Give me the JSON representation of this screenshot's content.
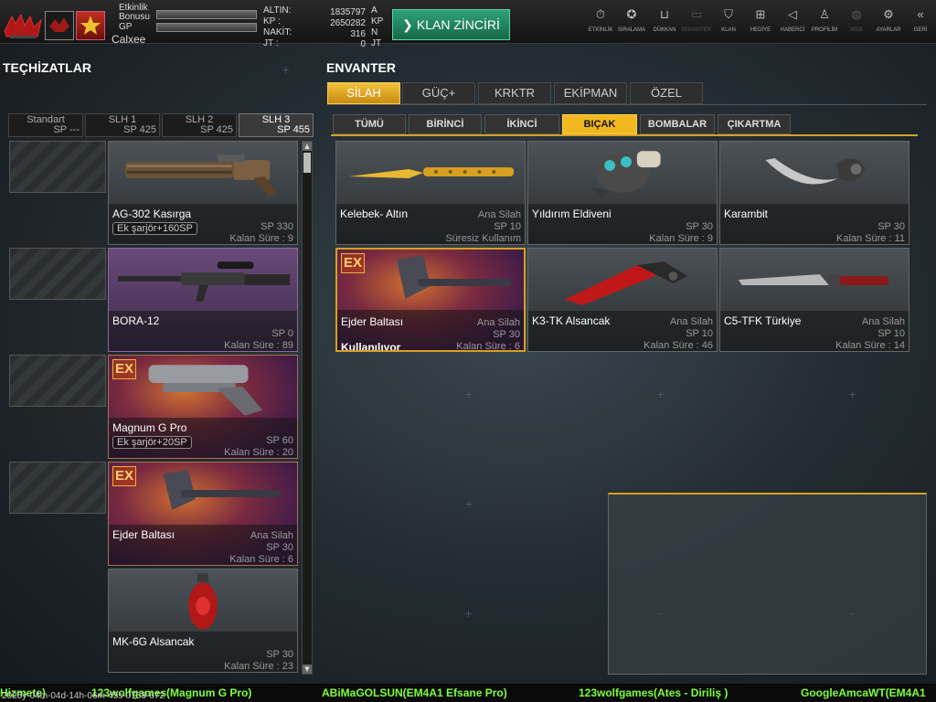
{
  "header": {
    "stats": [
      {
        "label": "Etkinlik"
      },
      {
        "label": "Bonusu"
      },
      {
        "label": "GP"
      }
    ],
    "username": "Calxee",
    "currencies": [
      {
        "label": "ALTIN:",
        "value": "1835797",
        "unit": "A"
      },
      {
        "label": "KP    :",
        "value": "2650282",
        "unit": "KP"
      },
      {
        "label": "NAKİT:",
        "value": "316",
        "unit": "N"
      },
      {
        "label": "JT    :",
        "value": "0",
        "unit": "JT"
      }
    ],
    "clan_chain_label": "KLAN ZİNCİRİ",
    "clan_chain_icon": "chevron-right-icon",
    "nav": [
      {
        "label": "ETKİNLİK",
        "icon": "stopwatch-icon"
      },
      {
        "label": "SIRALAMA",
        "icon": "medal-icon"
      },
      {
        "label": "DÜKKAN",
        "icon": "cart-icon"
      },
      {
        "label": "ENVANTER",
        "icon": "inventory-icon"
      },
      {
        "label": "KLAN",
        "icon": "shield-icon"
      },
      {
        "label": "HEDİYE",
        "icon": "gift-icon"
      },
      {
        "label": "HABERCİ",
        "icon": "megaphone-icon"
      },
      {
        "label": "PROFİLİM",
        "icon": "profile-icon"
      },
      {
        "label": "WEB",
        "icon": "globe-icon"
      },
      {
        "label": "AYARLAR",
        "icon": "gear-icon"
      },
      {
        "label": "GERİ",
        "icon": "back-arrows-icon"
      }
    ]
  },
  "equipment": {
    "title": "TEÇHİZATLAR",
    "slots": [
      {
        "name": "Standart",
        "sp": "SP ---"
      },
      {
        "name": "SLH 1",
        "sp": "SP 425"
      },
      {
        "name": "SLH 2",
        "sp": "SP 425"
      },
      {
        "name": "SLH 3",
        "sp": "SP 455"
      }
    ],
    "items": [
      {
        "name": "AG-302 Kasırga",
        "extra": "Ek şarjör+160SP",
        "sp": "SP 330",
        "duration": "Kalan Süre : 9"
      },
      {
        "name": "BORA-12",
        "sp": "SP 0",
        "duration": "Kalan Süre : 89"
      },
      {
        "badge": "EX",
        "name": "Magnum G Pro",
        "extra": "Ek şarjör+20SP",
        "sp": "SP 60",
        "duration": "Kalan Süre : 20"
      },
      {
        "badge": "EX",
        "name": "Ejder Baltası",
        "category": "Ana Silah",
        "sp": "SP 30",
        "duration": "Kalan Süre : 6"
      },
      {
        "name": "MK-6G Alsancak",
        "sp": "SP 30",
        "duration": "Kalan Süre : 23"
      }
    ]
  },
  "inventory": {
    "title": "ENVANTER",
    "main_tabs": [
      "SİLAH",
      "GÜÇ+",
      "KRKTR",
      "EKİPMAN",
      "ÖZEL"
    ],
    "sub_tabs": [
      "TÜMÜ",
      "BİRİNCİ",
      "İKİNCİ",
      "BIÇAK",
      "BOMBALAR",
      "ÇIKARTMA"
    ],
    "items": [
      {
        "name": "Kelebek- Altın",
        "category": "Ana Silah",
        "sp": "SP 10",
        "duration": "Süresiz Kullanım"
      },
      {
        "name": "Yıldırım Eldiveni",
        "sp": "SP 30",
        "duration": "Kalan Süre : 9"
      },
      {
        "name": "Karambit",
        "sp": "SP 30",
        "duration": "Kalan Süre : 11"
      },
      {
        "badge": "EX",
        "name": "Ejder Baltası",
        "category": "Ana Silah",
        "sp": "SP 30",
        "duration": "Kalan Süre : 6",
        "status": "Kullanılıyor"
      },
      {
        "name": "K3-TK Alsancak",
        "category": "Ana Silah",
        "sp": "SP 10",
        "duration": "Kalan Süre : 46"
      },
      {
        "name": "C5-TFK Türkiye",
        "category": "Ana Silah",
        "sp": "SP 10",
        "duration": "Kalan Süre : 14"
      }
    ]
  },
  "ticker": [
    "Hizmete)",
    "123wolfgames(Magnum G Pro)",
    "ABiMaGOLSUN(EM4A1 Efsane Pro)",
    "123wolfgames(Ates - Diriliş )",
    "GoogleAmcaWT(EM4A1"
  ],
  "timestamp": "2025y-04m-04d-14h-06m-45s-0753-672"
}
